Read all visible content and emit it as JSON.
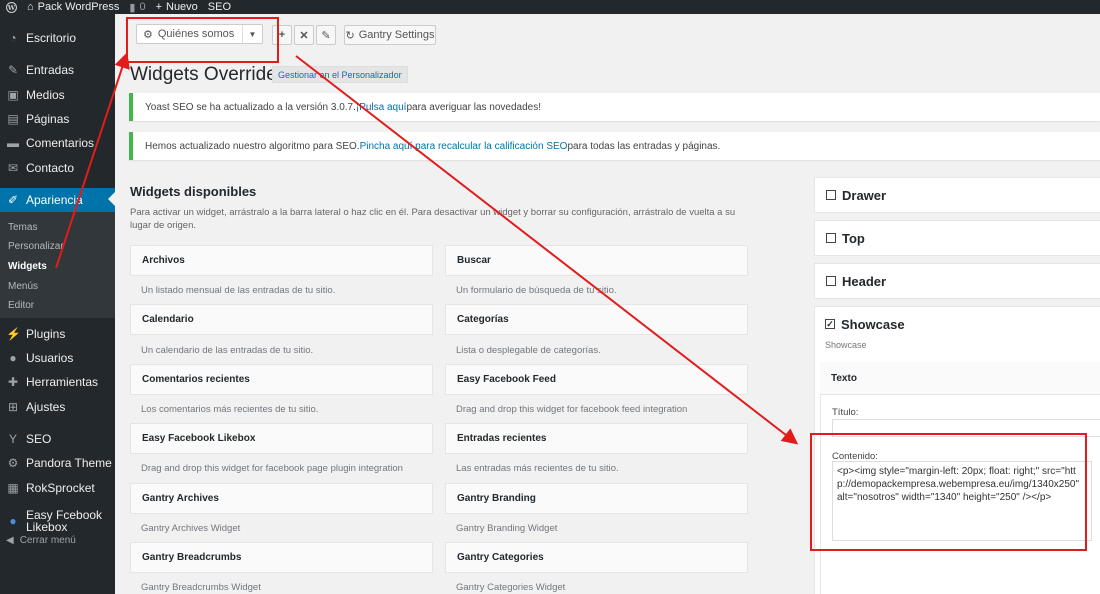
{
  "admin_bar": {
    "site_name": "Pack WordPress",
    "comments_count": "0",
    "new_label": "Nuevo",
    "seo_label": "SEO"
  },
  "sidebar": {
    "items": [
      {
        "label": "Escritorio",
        "icon": "dashboard-icon"
      },
      {
        "label": "Entradas",
        "icon": "pin-icon"
      },
      {
        "label": "Medios",
        "icon": "media-icon"
      },
      {
        "label": "Páginas",
        "icon": "page-icon"
      },
      {
        "label": "Comentarios",
        "icon": "comment-icon"
      },
      {
        "label": "Contacto",
        "icon": "mail-icon"
      },
      {
        "label": "Apariencia",
        "icon": "brush-icon"
      },
      {
        "label": "Plugins",
        "icon": "plug-icon"
      },
      {
        "label": "Usuarios",
        "icon": "user-icon"
      },
      {
        "label": "Herramientas",
        "icon": "wrench-icon"
      },
      {
        "label": "Ajustes",
        "icon": "settings-icon"
      },
      {
        "label": "SEO",
        "icon": "yoast-icon"
      },
      {
        "label": "Pandora Theme",
        "icon": "gear-icon"
      },
      {
        "label": "RokSprocket",
        "icon": "rocket-icon"
      },
      {
        "label": "Easy Fcebook Likebox",
        "icon": "facebook-icon"
      }
    ],
    "submenu": [
      "Temas",
      "Personalizar",
      "Widgets",
      "Menús",
      "Editor"
    ],
    "collapse_label": "Cerrar menú"
  },
  "toolbar": {
    "theme_selected": "Quiénes somos",
    "add_symbol": "+",
    "delete_symbol": "✕",
    "edit_symbol": "✎",
    "gantry_settings": "Gantry Settings"
  },
  "page": {
    "title": "Widgets Override",
    "customize_button": "Gestionar en el Personalizador"
  },
  "notices": {
    "n1_before": "Yoast SEO se ha actualizado a la versión 3.0.7. ",
    "n1_link": "¡Pulsa aquí",
    "n1_after": " para averiguar las novedades!",
    "n2_before": "Hemos actualizado nuestro algoritmo para SEO. ",
    "n2_link": "Pincha aquí para recalcular la calificación SEO",
    "n2_after": " para todas las entradas y páginas."
  },
  "available": {
    "title": "Widgets disponibles",
    "description": "Para activar un widget, arrástralo a la barra lateral o haz clic en él. Para desactivar un widget y borrar su configuración, arrástralo de vuelta a su lugar de origen."
  },
  "widgets": [
    {
      "title": "Archivos",
      "desc": "Un listado mensual de las entradas de tu sitio."
    },
    {
      "title": "Buscar",
      "desc": "Un formulario de búsqueda de tu sitio."
    },
    {
      "title": "Calendario",
      "desc": "Un calendario de las entradas de tu sitio."
    },
    {
      "title": "Categorías",
      "desc": "Lista o desplegable de categorías."
    },
    {
      "title": "Comentarios recientes",
      "desc": "Los comentarios más recientes de tu sitio."
    },
    {
      "title": "Easy Facebook Feed",
      "desc": "Drag and drop this widget for facebook feed integration"
    },
    {
      "title": "Easy Facebook Likebox",
      "desc": "Drag and drop this widget for facebook page plugin integration"
    },
    {
      "title": "Entradas recientes",
      "desc": "Las entradas más recientes de tu sitio."
    },
    {
      "title": "Gantry Archives",
      "desc": "Gantry Archives Widget"
    },
    {
      "title": "Gantry Branding",
      "desc": "Gantry Branding Widget"
    },
    {
      "title": "Gantry Breadcrumbs",
      "desc": "Gantry Breadcrumbs Widget"
    },
    {
      "title": "Gantry Categories",
      "desc": "Gantry Categories Widget"
    }
  ],
  "areas": {
    "drawer": "Drawer",
    "top": "Top",
    "header": "Header",
    "showcase": "Showcase",
    "showcase_sub": "Showcase"
  },
  "texto_widget": {
    "title": "Texto",
    "titulo_label": "Título:",
    "contenido_label": "Contenido:",
    "contenido_value": "<p><img style=\"margin-left: 20px; float: right;\" src=\"http://demopackempresa.webempresa.eu/img/1340x250\" alt=\"nosotros\" width=\"1340\" height=\"250\" /></p>"
  },
  "colors": {
    "admin_dark": "#23282d",
    "accent_blue": "#0073aa",
    "notice_green": "#46b450",
    "annotation_red": "#e21b1b"
  }
}
